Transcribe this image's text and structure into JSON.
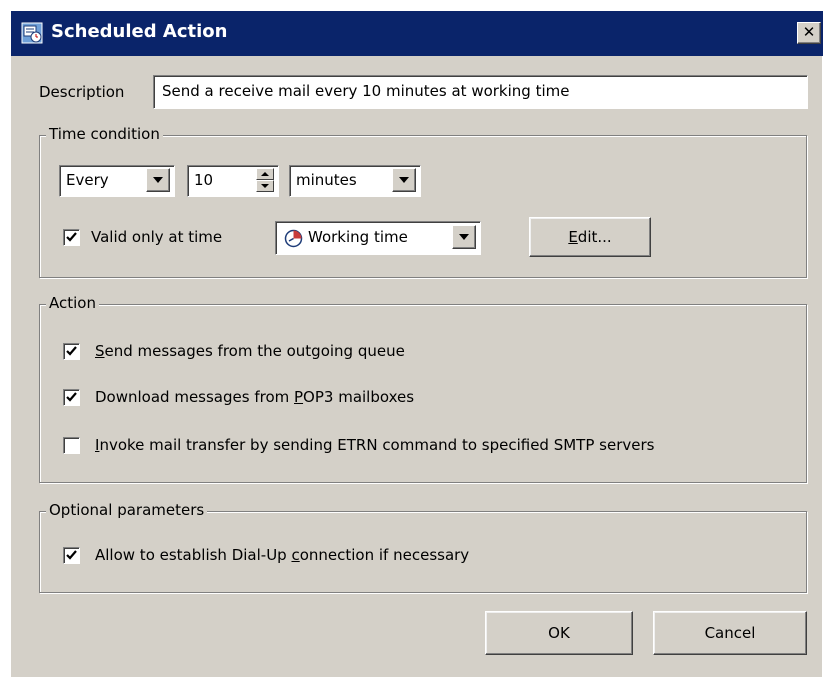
{
  "window": {
    "title": "Scheduled Action",
    "close_glyph": "✕",
    "icon": "scheduler-icon"
  },
  "description": {
    "label": "Description",
    "value": "Send a receive mail every 10 minutes at working time"
  },
  "time_condition": {
    "title": "Time condition",
    "frequency_select": "Every",
    "interval_value": "10",
    "unit_select": "minutes",
    "valid_only_label": "Valid only at time",
    "valid_only_checked": true,
    "schedule_select": "Working time",
    "edit_button": {
      "mnemonic": "E",
      "rest": "dit..."
    }
  },
  "action": {
    "title": "Action",
    "options": [
      {
        "mnemonic": "S",
        "pre": "",
        "rest": "end messages from the outgoing queue",
        "checked": true
      },
      {
        "pre": "Download messages from ",
        "mnemonic": "P",
        "rest": "OP3 mailboxes",
        "checked": true
      },
      {
        "mnemonic": "I",
        "pre": "",
        "rest": "nvoke mail transfer by sending ETRN command to specified SMTP servers",
        "checked": false
      }
    ]
  },
  "optional": {
    "title": "Optional parameters",
    "dialup": {
      "pre": "Allow to establish Dial-Up ",
      "mnemonic": "c",
      "rest": "onnection if necessary",
      "checked": true
    }
  },
  "buttons": {
    "ok": "OK",
    "cancel": "Cancel"
  },
  "colors": {
    "titlebar": "#0a246a",
    "face": "#d4d0c8"
  }
}
